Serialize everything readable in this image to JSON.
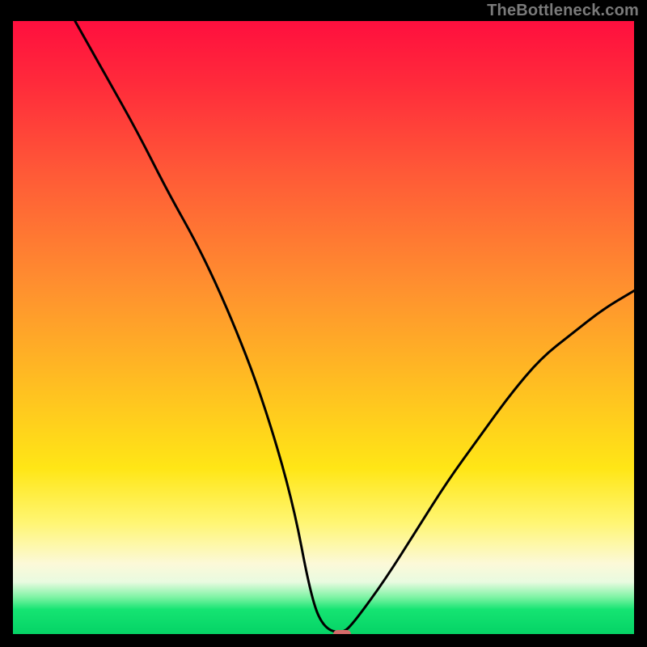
{
  "watermark": "TheBottleneck.com",
  "chart_data": {
    "type": "line",
    "title": "",
    "xlabel": "",
    "ylabel": "",
    "xlim": [
      0,
      100
    ],
    "ylim": [
      0,
      100
    ],
    "x": [
      10,
      15,
      20,
      25,
      30,
      35,
      40,
      45,
      48,
      50,
      53,
      55,
      60,
      65,
      70,
      75,
      80,
      85,
      90,
      95,
      100
    ],
    "values": [
      100,
      91,
      82,
      72,
      63,
      52,
      39,
      22,
      6,
      1,
      0,
      2,
      9,
      17,
      25,
      32,
      39,
      45,
      49,
      53,
      56
    ],
    "minimum": {
      "x": 53,
      "y": 0
    },
    "background": "rainbow-gradient"
  },
  "colors": {
    "curve": "#000000",
    "marker": "#d46a6a",
    "frame": "#000000"
  }
}
